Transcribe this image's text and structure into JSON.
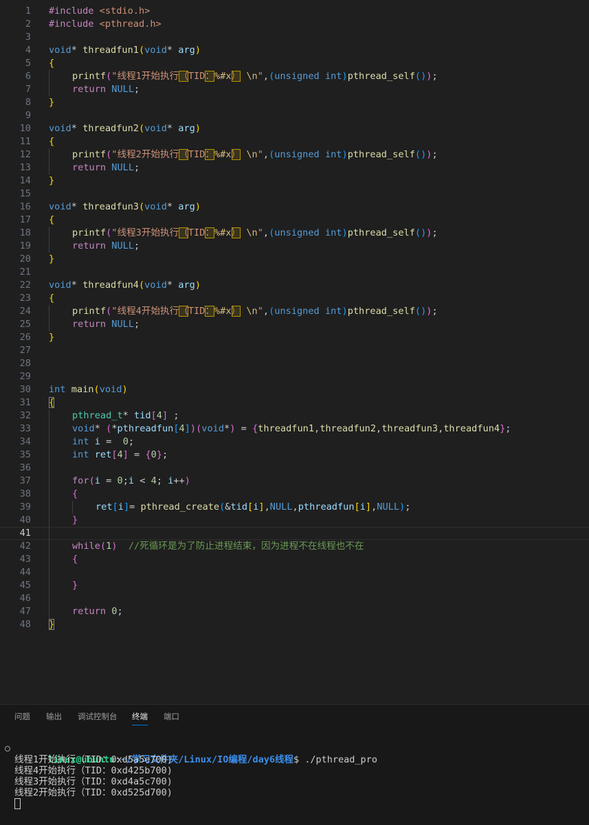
{
  "editor": {
    "current_line": 41,
    "lines": [
      {
        "n": 1,
        "indent": 0,
        "t": [
          [
            "#include",
            "pre"
          ],
          [
            " "
          ],
          [
            "<stdio.h>",
            "inc"
          ]
        ]
      },
      {
        "n": 2,
        "indent": 0,
        "t": [
          [
            "#include",
            "pre"
          ],
          [
            " "
          ],
          [
            "<pthread.h>",
            "inc"
          ]
        ]
      },
      {
        "n": 3,
        "indent": 0,
        "t": []
      },
      {
        "n": 4,
        "indent": 0,
        "t": [
          [
            "void",
            "kw"
          ],
          [
            "* "
          ],
          [
            "threadfun1",
            "fn"
          ],
          [
            "(",
            "b1"
          ],
          [
            "void",
            "kw"
          ],
          [
            "* "
          ],
          [
            "arg",
            "var"
          ],
          [
            ")",
            "b1"
          ]
        ]
      },
      {
        "n": 5,
        "indent": 0,
        "t": [
          [
            "{",
            "b1"
          ]
        ]
      },
      {
        "n": 6,
        "indent": 1,
        "t": [
          [
            "printf",
            "fn"
          ],
          [
            "(",
            "b2"
          ],
          [
            "\"线程1开始执行",
            "str"
          ],
          [
            "（",
            "str",
            "hl"
          ],
          [
            "TID",
            "str"
          ],
          [
            "：",
            "str",
            "hl"
          ],
          [
            "%#x",
            "esc"
          ],
          [
            "）",
            "str",
            "hl"
          ],
          [
            " ",
            "str"
          ],
          [
            "\\n",
            "esc"
          ],
          [
            "\"",
            "str"
          ],
          [
            ","
          ],
          [
            "(",
            "b3"
          ],
          [
            "unsigned",
            "kw"
          ],
          [
            " "
          ],
          [
            "int",
            "kw"
          ],
          [
            ")",
            "b3"
          ],
          [
            "pthread_self",
            "fn"
          ],
          [
            "()",
            "b3"
          ],
          [
            ")",
            "b2"
          ],
          [
            ";"
          ]
        ]
      },
      {
        "n": 7,
        "indent": 1,
        "t": [
          [
            "return",
            "ctl"
          ],
          [
            " "
          ],
          [
            "NULL",
            "kw"
          ],
          [
            ";"
          ]
        ]
      },
      {
        "n": 8,
        "indent": 0,
        "t": [
          [
            "}",
            "b1"
          ]
        ]
      },
      {
        "n": 9,
        "indent": 0,
        "t": []
      },
      {
        "n": 10,
        "indent": 0,
        "t": [
          [
            "void",
            "kw"
          ],
          [
            "* "
          ],
          [
            "threadfun2",
            "fn"
          ],
          [
            "(",
            "b1"
          ],
          [
            "void",
            "kw"
          ],
          [
            "* "
          ],
          [
            "arg",
            "var"
          ],
          [
            ")",
            "b1"
          ]
        ]
      },
      {
        "n": 11,
        "indent": 0,
        "t": [
          [
            "{",
            "b1"
          ]
        ]
      },
      {
        "n": 12,
        "indent": 1,
        "t": [
          [
            "printf",
            "fn"
          ],
          [
            "(",
            "b2"
          ],
          [
            "\"线程2开始执行",
            "str"
          ],
          [
            "（",
            "str",
            "hl"
          ],
          [
            "TID",
            "str"
          ],
          [
            "：",
            "str",
            "hl"
          ],
          [
            "%#x",
            "esc"
          ],
          [
            "）",
            "str",
            "hl"
          ],
          [
            " ",
            "str"
          ],
          [
            "\\n",
            "esc"
          ],
          [
            "\"",
            "str"
          ],
          [
            ","
          ],
          [
            "(",
            "b3"
          ],
          [
            "unsigned",
            "kw"
          ],
          [
            " "
          ],
          [
            "int",
            "kw"
          ],
          [
            ")",
            "b3"
          ],
          [
            "pthread_self",
            "fn"
          ],
          [
            "()",
            "b3"
          ],
          [
            ")",
            "b2"
          ],
          [
            ";"
          ]
        ]
      },
      {
        "n": 13,
        "indent": 1,
        "t": [
          [
            "return",
            "ctl"
          ],
          [
            " "
          ],
          [
            "NULL",
            "kw"
          ],
          [
            ";"
          ]
        ]
      },
      {
        "n": 14,
        "indent": 0,
        "t": [
          [
            "}",
            "b1"
          ]
        ]
      },
      {
        "n": 15,
        "indent": 0,
        "t": []
      },
      {
        "n": 16,
        "indent": 0,
        "t": [
          [
            "void",
            "kw"
          ],
          [
            "* "
          ],
          [
            "threadfun3",
            "fn"
          ],
          [
            "(",
            "b1"
          ],
          [
            "void",
            "kw"
          ],
          [
            "* "
          ],
          [
            "arg",
            "var"
          ],
          [
            ")",
            "b1"
          ]
        ]
      },
      {
        "n": 17,
        "indent": 0,
        "t": [
          [
            "{",
            "b1"
          ]
        ]
      },
      {
        "n": 18,
        "indent": 1,
        "t": [
          [
            "printf",
            "fn"
          ],
          [
            "(",
            "b2"
          ],
          [
            "\"线程3开始执行",
            "str"
          ],
          [
            "（",
            "str",
            "hl"
          ],
          [
            "TID",
            "str"
          ],
          [
            "：",
            "str",
            "hl"
          ],
          [
            "%#x",
            "esc"
          ],
          [
            "）",
            "str",
            "hl"
          ],
          [
            " ",
            "str"
          ],
          [
            "\\n",
            "esc"
          ],
          [
            "\"",
            "str"
          ],
          [
            ","
          ],
          [
            "(",
            "b3"
          ],
          [
            "unsigned",
            "kw"
          ],
          [
            " "
          ],
          [
            "int",
            "kw"
          ],
          [
            ")",
            "b3"
          ],
          [
            "pthread_self",
            "fn"
          ],
          [
            "()",
            "b3"
          ],
          [
            ")",
            "b2"
          ],
          [
            ";"
          ]
        ]
      },
      {
        "n": 19,
        "indent": 1,
        "t": [
          [
            "return",
            "ctl"
          ],
          [
            " "
          ],
          [
            "NULL",
            "kw"
          ],
          [
            ";"
          ]
        ]
      },
      {
        "n": 20,
        "indent": 0,
        "t": [
          [
            "}",
            "b1"
          ]
        ]
      },
      {
        "n": 21,
        "indent": 0,
        "t": []
      },
      {
        "n": 22,
        "indent": 0,
        "t": [
          [
            "void",
            "kw"
          ],
          [
            "* "
          ],
          [
            "threadfun4",
            "fn"
          ],
          [
            "(",
            "b1"
          ],
          [
            "void",
            "kw"
          ],
          [
            "* "
          ],
          [
            "arg",
            "var"
          ],
          [
            ")",
            "b1"
          ]
        ]
      },
      {
        "n": 23,
        "indent": 0,
        "t": [
          [
            "{",
            "b1"
          ]
        ]
      },
      {
        "n": 24,
        "indent": 1,
        "t": [
          [
            "printf",
            "fn"
          ],
          [
            "(",
            "b2"
          ],
          [
            "\"线程4开始执行",
            "str"
          ],
          [
            "（",
            "str",
            "hl"
          ],
          [
            "TID",
            "str"
          ],
          [
            "：",
            "str",
            "hl"
          ],
          [
            "%#x",
            "esc"
          ],
          [
            "）",
            "str",
            "hl"
          ],
          [
            " ",
            "str"
          ],
          [
            "\\n",
            "esc"
          ],
          [
            "\"",
            "str"
          ],
          [
            ","
          ],
          [
            "(",
            "b3"
          ],
          [
            "unsigned",
            "kw"
          ],
          [
            " "
          ],
          [
            "int",
            "kw"
          ],
          [
            ")",
            "b3"
          ],
          [
            "pthread_self",
            "fn"
          ],
          [
            "()",
            "b3"
          ],
          [
            ")",
            "b2"
          ],
          [
            ";"
          ]
        ]
      },
      {
        "n": 25,
        "indent": 1,
        "t": [
          [
            "return",
            "ctl"
          ],
          [
            " "
          ],
          [
            "NULL",
            "kw"
          ],
          [
            ";"
          ]
        ]
      },
      {
        "n": 26,
        "indent": 0,
        "t": [
          [
            "}",
            "b1"
          ]
        ]
      },
      {
        "n": 27,
        "indent": 0,
        "t": []
      },
      {
        "n": 28,
        "indent": 0,
        "t": []
      },
      {
        "n": 29,
        "indent": 0,
        "t": []
      },
      {
        "n": 30,
        "indent": 0,
        "t": [
          [
            "int",
            "kw"
          ],
          [
            " "
          ],
          [
            "main",
            "fn"
          ],
          [
            "(",
            "b1"
          ],
          [
            "void",
            "kw"
          ],
          [
            ")",
            "b1"
          ]
        ]
      },
      {
        "n": 31,
        "indent": 0,
        "t": [
          [
            "{",
            "b1",
            "bm"
          ]
        ]
      },
      {
        "n": 32,
        "indent": 1,
        "t": [
          [
            "pthread_t",
            "typ"
          ],
          [
            "* "
          ],
          [
            "tid",
            "var"
          ],
          [
            "[",
            "b2"
          ],
          [
            "4",
            "num"
          ],
          [
            "]",
            "b2"
          ],
          [
            " ;"
          ]
        ]
      },
      {
        "n": 33,
        "indent": 1,
        "t": [
          [
            "void",
            "kw"
          ],
          [
            "* "
          ],
          [
            "(",
            "b2"
          ],
          [
            "*",
            "pl"
          ],
          [
            "pthreadfun",
            "var"
          ],
          [
            "[",
            "b3"
          ],
          [
            "4",
            "num"
          ],
          [
            "]",
            "b3"
          ],
          [
            ")",
            "b2"
          ],
          [
            "(",
            "b2"
          ],
          [
            "void",
            "kw"
          ],
          [
            "*",
            "pl"
          ],
          [
            ")",
            "b2"
          ],
          [
            " = "
          ],
          [
            "{",
            "b2"
          ],
          [
            "threadfun1",
            "fn"
          ],
          [
            ","
          ],
          [
            "threadfun2",
            "fn"
          ],
          [
            ","
          ],
          [
            "threadfun3",
            "fn"
          ],
          [
            ","
          ],
          [
            "threadfun4",
            "fn"
          ],
          [
            "}",
            "b2"
          ],
          [
            ";"
          ]
        ]
      },
      {
        "n": 34,
        "indent": 1,
        "t": [
          [
            "int",
            "kw"
          ],
          [
            " "
          ],
          [
            "i",
            "var"
          ],
          [
            " =  "
          ],
          [
            "0",
            "num"
          ],
          [
            ";"
          ]
        ]
      },
      {
        "n": 35,
        "indent": 1,
        "t": [
          [
            "int",
            "kw"
          ],
          [
            " "
          ],
          [
            "ret",
            "var"
          ],
          [
            "[",
            "b2"
          ],
          [
            "4",
            "num"
          ],
          [
            "]",
            "b2"
          ],
          [
            " = "
          ],
          [
            "{",
            "b2"
          ],
          [
            "0",
            "num"
          ],
          [
            "}",
            "b2"
          ],
          [
            ";"
          ]
        ]
      },
      {
        "n": 36,
        "indent": 1,
        "t": []
      },
      {
        "n": 37,
        "indent": 1,
        "t": [
          [
            "for",
            "ctl"
          ],
          [
            "(",
            "b2"
          ],
          [
            "i",
            "var"
          ],
          [
            " = "
          ],
          [
            "0",
            "num"
          ],
          [
            ";"
          ],
          [
            "i",
            "var"
          ],
          [
            " < "
          ],
          [
            "4",
            "num"
          ],
          [
            "; "
          ],
          [
            "i",
            "var"
          ],
          [
            "++"
          ],
          [
            ")",
            "b2"
          ]
        ]
      },
      {
        "n": 38,
        "indent": 1,
        "t": [
          [
            "{",
            "b2"
          ]
        ]
      },
      {
        "n": 39,
        "indent": 2,
        "t": [
          [
            "ret",
            "var"
          ],
          [
            "[",
            "b3"
          ],
          [
            "i",
            "var"
          ],
          [
            "]",
            "b3"
          ],
          [
            "= "
          ],
          [
            "pthread_create",
            "fn"
          ],
          [
            "(",
            "b3"
          ],
          [
            "&"
          ],
          [
            "tid",
            "var"
          ],
          [
            "[",
            "b1"
          ],
          [
            "i",
            "var"
          ],
          [
            "]",
            "b1"
          ],
          [
            ","
          ],
          [
            "NULL",
            "kw"
          ],
          [
            ","
          ],
          [
            "pthreadfun",
            "var"
          ],
          [
            "[",
            "b1"
          ],
          [
            "i",
            "var"
          ],
          [
            "]",
            "b1"
          ],
          [
            ","
          ],
          [
            "NULL",
            "kw"
          ],
          [
            ")",
            "b3"
          ],
          [
            ";"
          ]
        ]
      },
      {
        "n": 40,
        "indent": 1,
        "t": [
          [
            "}",
            "b2"
          ]
        ]
      },
      {
        "n": 41,
        "indent": 1,
        "t": []
      },
      {
        "n": 42,
        "indent": 1,
        "t": [
          [
            "while",
            "ctl"
          ],
          [
            "(",
            "b2"
          ],
          [
            "1",
            "num"
          ],
          [
            ")",
            "b2"
          ],
          [
            "  "
          ],
          [
            "//死循环是为了防止进程结束，因为进程不在线程也不在",
            "com"
          ]
        ]
      },
      {
        "n": 43,
        "indent": 1,
        "t": [
          [
            "{",
            "b2"
          ]
        ]
      },
      {
        "n": 44,
        "indent": 1,
        "t": []
      },
      {
        "n": 45,
        "indent": 1,
        "t": [
          [
            "}",
            "b2"
          ]
        ]
      },
      {
        "n": 46,
        "indent": 1,
        "t": []
      },
      {
        "n": 47,
        "indent": 1,
        "t": [
          [
            "return",
            "ctl"
          ],
          [
            " "
          ],
          [
            "0",
            "num"
          ],
          [
            ";"
          ]
        ]
      },
      {
        "n": 48,
        "indent": 0,
        "t": [
          [
            "}",
            "b1",
            "bm"
          ]
        ]
      }
    ]
  },
  "panel": {
    "tabs": [
      {
        "label": "问题",
        "active": false
      },
      {
        "label": "输出",
        "active": false
      },
      {
        "label": "调试控制台",
        "active": false
      },
      {
        "label": "终端",
        "active": true
      },
      {
        "label": "端口",
        "active": false
      }
    ]
  },
  "terminal": {
    "prompt_user": "linux@ubuntu",
    "prompt_colon": ":",
    "prompt_path": "~/学习文件夹/Linux/IO编程/day6线程",
    "prompt_symbol": "$ ",
    "command": "./pthread_pro",
    "output": [
      "线程1开始执行（TID：0xd5a5e700)",
      "线程4开始执行（TID：0xd425b700)",
      "线程3开始执行（TID：0xd4a5c700)",
      "线程2开始执行（TID：0xd525d700)"
    ]
  }
}
